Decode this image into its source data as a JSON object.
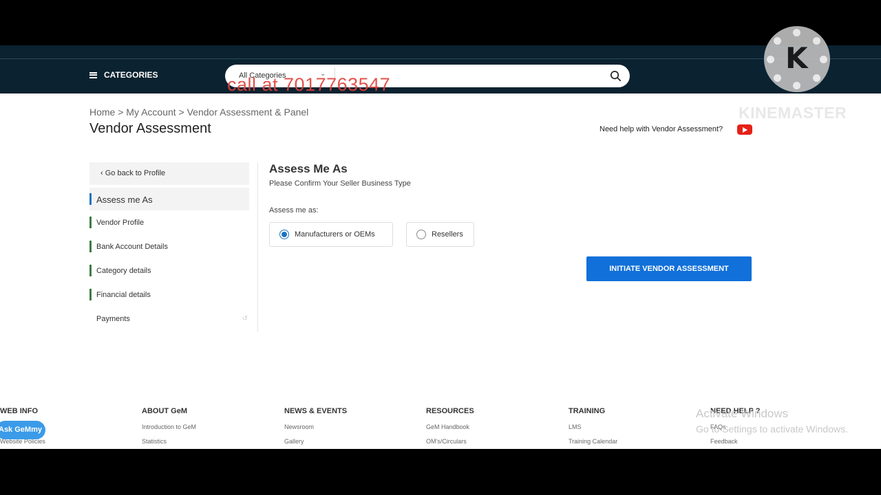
{
  "navbar": {
    "categories_label": "CATEGORIES",
    "search": {
      "category": "All Categories",
      "placeholder": ""
    }
  },
  "overlay": {
    "call_text": "call at 7017763547",
    "watermark": "KINEMASTER",
    "logo_letter": "K"
  },
  "breadcrumb": "Home > My Account > Vendor Assessment & Panel",
  "page_title": "Vendor Assessment",
  "help_text": "Need help with Vendor Assessment?",
  "sidebar": {
    "back": "Go back to Profile",
    "items": [
      {
        "label": "Assess me As",
        "active": true
      },
      {
        "label": "Vendor Profile"
      },
      {
        "label": "Bank Account Details"
      },
      {
        "label": "Category details"
      },
      {
        "label": "Financial details"
      },
      {
        "label": "Payments"
      }
    ]
  },
  "main": {
    "title": "Assess Me As",
    "subtitle": "Please Confirm Your Seller Business Type",
    "assess_label": "Assess me as:",
    "options": [
      {
        "label": "Manufacturers or OEMs",
        "selected": true
      },
      {
        "label": "Resellers",
        "selected": false
      }
    ],
    "initiate_button": "INITIATE VENDOR ASSESSMENT"
  },
  "footer": {
    "ask_gemmy": "Ask GeMmy",
    "columns": [
      {
        "heading": "WEB INFO",
        "links": [
          "",
          "Website Policies"
        ]
      },
      {
        "heading": "ABOUT GeM",
        "links": [
          "Introduction to GeM",
          "Statistics"
        ]
      },
      {
        "heading": "NEWS & EVENTS",
        "links": [
          "Newsroom",
          "Gallery"
        ]
      },
      {
        "heading": "RESOURCES",
        "links": [
          "GeM Handbook",
          "OM's/Circulars"
        ]
      },
      {
        "heading": "TRAINING",
        "links": [
          "LMS",
          "Training Calendar"
        ]
      },
      {
        "heading": "NEED HELP ?",
        "links": [
          "FAQs",
          "Feedback"
        ]
      }
    ],
    "activate_title": "Activate Windows",
    "activate_sub": "Go to Settings to activate Windows."
  },
  "colors": {
    "navbar": "#0b2230",
    "primary": "#1170d9",
    "active_bar": "#1e73be",
    "done_bar": "#3a7d44"
  }
}
